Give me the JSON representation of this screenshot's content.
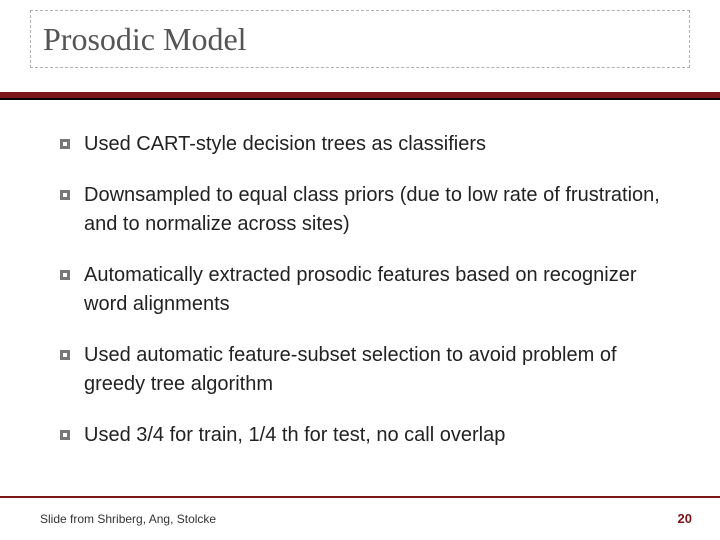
{
  "title": "Prosodic Model",
  "bullets": [
    "Used CART-style decision trees as classifiers",
    "Downsampled to equal class priors (due to low rate of frustration, and to normalize across sites)",
    "Automatically extracted prosodic features based on recognizer word alignments",
    "Used automatic feature-subset selection to avoid problem of greedy tree algorithm",
    "Used 3/4 for train, 1/4 th for test, no call overlap"
  ],
  "credit": "Slide from Shriberg, Ang, Stolcke",
  "page_number": "20"
}
